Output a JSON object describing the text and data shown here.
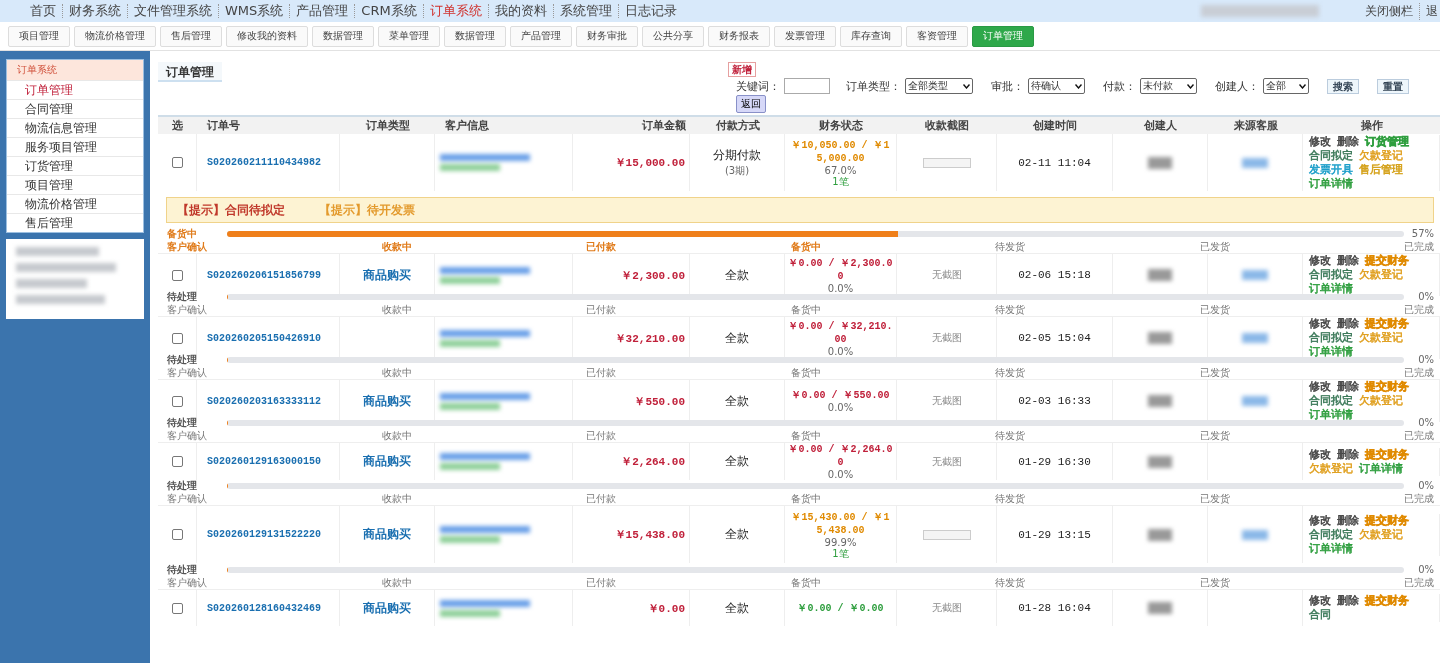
{
  "top_nav": {
    "items": [
      {
        "label": "首页",
        "selected": false
      },
      {
        "label": "财务系统",
        "selected": false
      },
      {
        "label": "文件管理系统",
        "selected": false
      },
      {
        "label": "WMS系统",
        "selected": false
      },
      {
        "label": "产品管理",
        "selected": false
      },
      {
        "label": "CRM系统",
        "selected": false
      },
      {
        "label": "订单系统",
        "selected": true
      },
      {
        "label": "我的资料",
        "selected": false
      },
      {
        "label": "系统管理",
        "selected": false
      },
      {
        "label": "日志记录",
        "selected": false
      }
    ],
    "close_sidebar": "关闭侧栏",
    "exit": "退"
  },
  "toolbar": [
    {
      "label": "项目管理",
      "selected": false
    },
    {
      "label": "物流价格管理",
      "selected": false
    },
    {
      "label": "售后管理",
      "selected": false
    },
    {
      "label": "修改我的资料",
      "selected": false
    },
    {
      "label": "数据管理",
      "selected": false
    },
    {
      "label": "菜单管理",
      "selected": false
    },
    {
      "label": "数据管理",
      "selected": false
    },
    {
      "label": "产品管理",
      "selected": false
    },
    {
      "label": "财务审批",
      "selected": false
    },
    {
      "label": "公共分享",
      "selected": false
    },
    {
      "label": "财务报表",
      "selected": false
    },
    {
      "label": "发票管理",
      "selected": false
    },
    {
      "label": "库存查询",
      "selected": false
    },
    {
      "label": "客资管理",
      "selected": false
    },
    {
      "label": "订单管理",
      "selected": true
    }
  ],
  "sidebar": {
    "title": "订单系统",
    "items": [
      {
        "label": "订单管理",
        "selected": true
      },
      {
        "label": "合同管理",
        "selected": false
      },
      {
        "label": "物流信息管理",
        "selected": false
      },
      {
        "label": "服务项目管理",
        "selected": false
      },
      {
        "label": "订货管理",
        "selected": false
      },
      {
        "label": "项目管理",
        "selected": false
      },
      {
        "label": "物流价格管理",
        "selected": false
      },
      {
        "label": "售后管理",
        "selected": false
      }
    ]
  },
  "page_title": "订单管理",
  "new_button": "新增",
  "filters": {
    "keyword_label": "关键词：",
    "selects": [
      {
        "label": "订单类型：",
        "value": "全部类型"
      },
      {
        "label": "审批：",
        "value": "待确认"
      },
      {
        "label": "付款：",
        "value": "未付款"
      },
      {
        "label": "创建人：",
        "value": "全部"
      }
    ],
    "search_button": "搜索",
    "reset_button": "重置",
    "back_button": "返回"
  },
  "table": {
    "columns": [
      "选",
      "订单号",
      "订单类型",
      "客户信息",
      "订单金额",
      "付款方式",
      "财务状态",
      "收款截图",
      "创建时间",
      "创建人",
      "来源客服",
      "操作"
    ],
    "orders": [
      {
        "checked": false,
        "order_no": "S020260211110434982",
        "amount": "￥15,000.00",
        "payment": "分期付款",
        "payment_note": "(3期)",
        "finance": {
          "kind": "partial",
          "amount": "￥10,050.00 / ￥15,000.00",
          "percent": "67.0%",
          "count": "1笔"
        },
        "receipt": {
          "kind": "thumbnail"
        },
        "created": "02-11 11:04",
        "source_blurred": true,
        "actions": [
          {
            "label": "修改",
            "color": "#444444",
            "bold": false
          },
          {
            "label": "删除",
            "color": "#444444",
            "bold": false
          },
          {
            "label": "订货管理",
            "color": "#2e9e3e",
            "bold": true
          },
          {
            "label": "合同拟定",
            "color": "#3d7a5a",
            "bold": false
          },
          {
            "label": "欠款登记",
            "color": "#e0a020",
            "bold": false
          },
          {
            "label": "发票开具",
            "color": "#1a9ec9",
            "bold": false
          },
          {
            "label": "售后管理",
            "color": "#d4a017",
            "bold": false
          },
          {
            "label": "订单详情",
            "color": "#2e9e3e",
            "bold": false
          }
        ],
        "notices": [
          {
            "text": "【提示】合同待拟定",
            "color": "#c0392b"
          },
          {
            "text": "【提示】待开发票",
            "color": "#e39a2d"
          }
        ],
        "progress": {
          "label": "备货中",
          "active": true,
          "level": 0.57,
          "reading": "57%"
        },
        "steps": [
          {
            "label": "客户确认",
            "done": true
          },
          {
            "label": "收款中",
            "done": true
          },
          {
            "label": "已付款",
            "done": true
          },
          {
            "label": "备货中",
            "done": true
          },
          {
            "label": "待发货",
            "done": false
          },
          {
            "label": "已发货",
            "done": false
          },
          {
            "label": "已完成",
            "done": false
          }
        ]
      },
      {
        "checked": false,
        "order_no": "S020260206151856799",
        "type": "商品购买",
        "amount": "￥2,300.00",
        "payment": "全款",
        "finance": {
          "kind": "unpaid",
          "amount": "￥0.00 / ￥2,300.00",
          "percent": "0.0%"
        },
        "receipt": {
          "kind": "none",
          "text": "无截图"
        },
        "created": "02-06 15:18",
        "source_blurred": true,
        "actions": [
          {
            "label": "修改",
            "color": "#444444",
            "bold": false
          },
          {
            "label": "删除",
            "color": "#444444",
            "bold": false
          },
          {
            "label": "提交财务",
            "color": "#e08a00",
            "bold": true
          },
          {
            "label": "合同拟定",
            "color": "#3d7a5a",
            "bold": false
          },
          {
            "label": "欠款登记",
            "color": "#e0a020",
            "bold": false
          },
          {
            "label": "订单详情",
            "color": "#2e9e3e",
            "bold": false
          }
        ],
        "progress": {
          "label": "待处理",
          "active": false,
          "level": 0,
          "reading": "0%"
        },
        "steps": [
          {
            "label": "客户确认",
            "done": false
          },
          {
            "label": "收款中",
            "done": false
          },
          {
            "label": "已付款",
            "done": false
          },
          {
            "label": "备货中",
            "done": false
          },
          {
            "label": "待发货",
            "done": false
          },
          {
            "label": "已发货",
            "done": false
          },
          {
            "label": "已完成",
            "done": false
          }
        ]
      },
      {
        "checked": false,
        "order_no": "S020260205150426910",
        "amount": "￥32,210.00",
        "payment": "全款",
        "finance": {
          "kind": "unpaid",
          "amount": "￥0.00 / ￥32,210.00",
          "percent": "0.0%"
        },
        "receipt": {
          "kind": "none",
          "text": "无截图"
        },
        "created": "02-05 15:04",
        "source_blurred": true,
        "actions": [
          {
            "label": "修改",
            "color": "#444444",
            "bold": false
          },
          {
            "label": "删除",
            "color": "#444444",
            "bold": false
          },
          {
            "label": "提交财务",
            "color": "#e08a00",
            "bold": true
          },
          {
            "label": "合同拟定",
            "color": "#3d7a5a",
            "bold": false
          },
          {
            "label": "欠款登记",
            "color": "#e0a020",
            "bold": false
          },
          {
            "label": "订单详情",
            "color": "#2e9e3e",
            "bold": false
          }
        ],
        "progress": {
          "label": "待处理",
          "active": false,
          "level": 0,
          "reading": "0%"
        },
        "steps": [
          {
            "label": "客户确认",
            "done": false
          },
          {
            "label": "收款中",
            "done": false
          },
          {
            "label": "已付款",
            "done": false
          },
          {
            "label": "备货中",
            "done": false
          },
          {
            "label": "待发货",
            "done": false
          },
          {
            "label": "已发货",
            "done": false
          },
          {
            "label": "已完成",
            "done": false
          }
        ]
      },
      {
        "checked": false,
        "order_no": "S020260203163333112",
        "type": "商品购买",
        "amount": "￥550.00",
        "payment": "全款",
        "finance": {
          "kind": "unpaid",
          "amount": "￥0.00 / ￥550.00",
          "percent": "0.0%"
        },
        "receipt": {
          "kind": "none",
          "text": "无截图"
        },
        "created": "02-03 16:33",
        "source_blurred": true,
        "actions": [
          {
            "label": "修改",
            "color": "#444444",
            "bold": false
          },
          {
            "label": "删除",
            "color": "#444444",
            "bold": false
          },
          {
            "label": "提交财务",
            "color": "#e08a00",
            "bold": true
          },
          {
            "label": "合同拟定",
            "color": "#3d7a5a",
            "bold": false
          },
          {
            "label": "欠款登记",
            "color": "#e0a020",
            "bold": false
          },
          {
            "label": "订单详情",
            "color": "#2e9e3e",
            "bold": false
          }
        ],
        "progress": {
          "label": "待处理",
          "active": false,
          "level": 0,
          "reading": "0%"
        },
        "steps": [
          {
            "label": "客户确认",
            "done": false
          },
          {
            "label": "收款中",
            "done": false
          },
          {
            "label": "已付款",
            "done": false
          },
          {
            "label": "备货中",
            "done": false
          },
          {
            "label": "待发货",
            "done": false
          },
          {
            "label": "已发货",
            "done": false
          },
          {
            "label": "已完成",
            "done": false
          }
        ]
      },
      {
        "checked": false,
        "order_no": "S020260129163000150",
        "type": "商品购买",
        "amount": "￥2,264.00",
        "payment": "全款",
        "finance": {
          "kind": "unpaid",
          "amount": "￥0.00 / ￥2,264.00",
          "percent": "0.0%"
        },
        "receipt": {
          "kind": "none",
          "text": "无截图"
        },
        "created": "01-29 16:30",
        "source_blurred": false,
        "actions": [
          {
            "label": "修改",
            "color": "#444444",
            "bold": false
          },
          {
            "label": "删除",
            "color": "#444444",
            "bold": false
          },
          {
            "label": "提交财务",
            "color": "#e08a00",
            "bold": true
          },
          {
            "label": "欠款登记",
            "color": "#e0a020",
            "bold": false
          },
          {
            "label": "订单详情",
            "color": "#2e9e3e",
            "bold": false
          }
        ],
        "progress": {
          "label": "待处理",
          "active": false,
          "level": 0,
          "reading": "0%"
        },
        "steps": [
          {
            "label": "客户确认",
            "done": false
          },
          {
            "label": "收款中",
            "done": false
          },
          {
            "label": "已付款",
            "done": false
          },
          {
            "label": "备货中",
            "done": false
          },
          {
            "label": "待发货",
            "done": false
          },
          {
            "label": "已发货",
            "done": false
          },
          {
            "label": "已完成",
            "done": false
          }
        ]
      },
      {
        "checked": false,
        "order_no": "S020260129131522220",
        "type": "商品购买",
        "amount": "￥15,438.00",
        "payment": "全款",
        "finance": {
          "kind": "partial",
          "amount": "￥15,430.00 / ￥15,438.00",
          "percent": "99.9%",
          "count": "1笔"
        },
        "receipt": {
          "kind": "thumbnail"
        },
        "created": "01-29 13:15",
        "source_blurred": true,
        "actions": [
          {
            "label": "修改",
            "color": "#444444",
            "bold": false
          },
          {
            "label": "删除",
            "color": "#444444",
            "bold": false
          },
          {
            "label": "提交财务",
            "color": "#e08a00",
            "bold": true
          },
          {
            "label": "合同拟定",
            "color": "#3d7a5a",
            "bold": false
          },
          {
            "label": "欠款登记",
            "color": "#e0a020",
            "bold": false
          },
          {
            "label": "订单详情",
            "color": "#2e9e3e",
            "bold": false
          }
        ],
        "progress": {
          "label": "待处理",
          "active": false,
          "level": 0,
          "reading": "0%"
        },
        "steps": [
          {
            "label": "客户确认",
            "done": false
          },
          {
            "label": "收款中",
            "done": false
          },
          {
            "label": "已付款",
            "done": false
          },
          {
            "label": "备货中",
            "done": false
          },
          {
            "label": "待发货",
            "done": false
          },
          {
            "label": "已发货",
            "done": false
          },
          {
            "label": "已完成",
            "done": false
          }
        ]
      },
      {
        "checked": false,
        "order_no": "S020260128160432469",
        "type": "商品购买",
        "amount": "￥0.00",
        "payment": "全款",
        "finance": {
          "kind": "paid",
          "amount": "￥0.00 / ￥0.00"
        },
        "receipt": {
          "kind": "none",
          "text": "无截图"
        },
        "created": "01-28 16:04",
        "source_blurred": false,
        "actions": [
          {
            "label": "修改",
            "color": "#444444",
            "bold": false
          },
          {
            "label": "删除",
            "color": "#444444",
            "bold": false
          },
          {
            "label": "提交财务",
            "color": "#e08a00",
            "bold": true
          },
          {
            "label": "合同",
            "color": "#3d7a5a",
            "bold": false
          }
        ]
      }
    ]
  }
}
